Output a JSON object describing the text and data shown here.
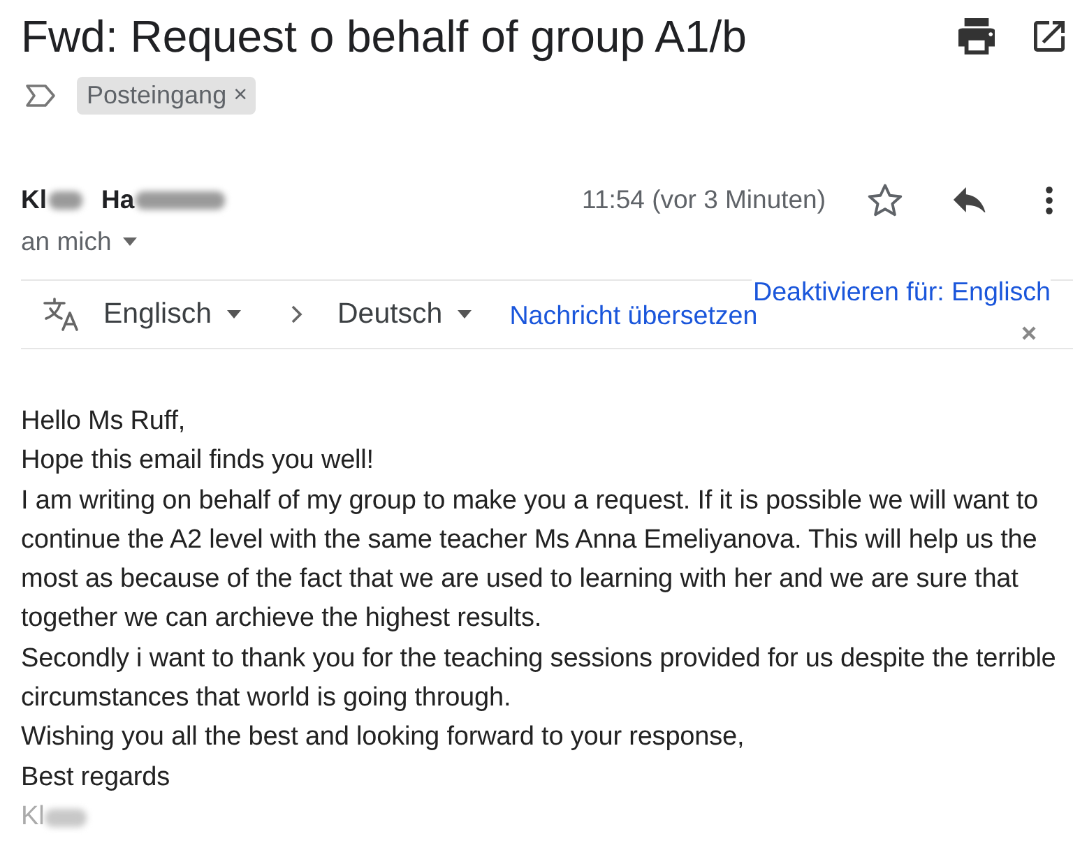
{
  "header": {
    "title": "Fwd: Request o behalf of group A1/b",
    "labels": [
      {
        "text": "Posteingang",
        "remove_symbol": "×"
      }
    ]
  },
  "message": {
    "sender": {
      "first": "Kl",
      "last": "Ha",
      "redacted": true
    },
    "time": "11:54 (vor 3 Minuten)",
    "starred": false,
    "recipient": "an mich"
  },
  "translate_bar": {
    "source_language": "Englisch",
    "target_language": "Deutsch",
    "action": "Nachricht übersetzen",
    "disable_link": "Deaktivieren für: Englisch"
  },
  "body": {
    "paragraphs": [
      "Hello Ms Ruff,",
      "Hope this email finds you well!",
      "I am writing on behalf of my group to make you a request. If it is possible we will want to continue the A2 level with the same teacher Ms Anna Emeliyanova. This will help us the most as because of the fact that we are used to learning with her and we are sure that together we can archieve the highest results.",
      "Secondly i want to thank you for the teaching sessions provided for us despite the terrible circumstances that world is going through.",
      "Wishing you all the best and looking forward to your response,",
      "Best regards"
    ],
    "signature": {
      "text": "Kl",
      "redacted": true
    }
  }
}
